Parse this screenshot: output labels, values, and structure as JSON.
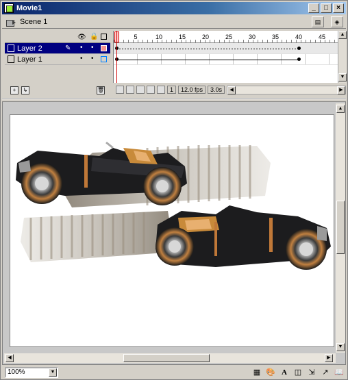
{
  "window": {
    "title": "Movie1"
  },
  "titlebar_buttons": [
    "_",
    "□",
    "×"
  ],
  "scene": {
    "label": "Scene 1"
  },
  "timeline": {
    "ruler_ticks": [
      "1",
      "5",
      "10",
      "15",
      "20",
      "25",
      "30",
      "35",
      "40",
      "45"
    ],
    "layers": [
      {
        "name": "Layer 2",
        "selected": true
      },
      {
        "name": "Layer 1",
        "selected": false
      }
    ],
    "fps": "12.0 fps",
    "time": "3.0s"
  },
  "statusbar": {
    "zoom": "100%"
  },
  "colors": {
    "accent": "#000080",
    "stage_bg": "#ffffff",
    "playhead": "#d00000"
  }
}
